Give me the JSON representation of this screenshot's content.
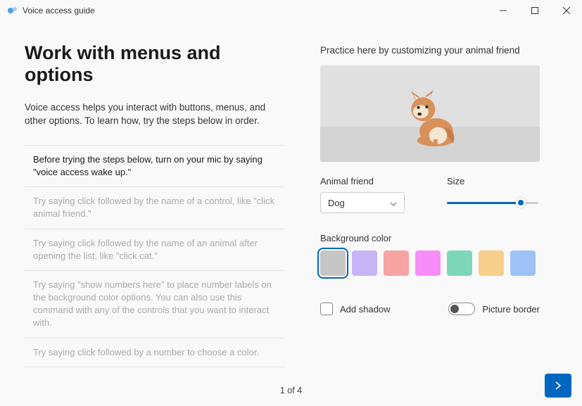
{
  "window": {
    "title": "Voice access guide"
  },
  "header": {
    "title": "Work with menus and options",
    "subtitle": "Voice access helps you interact with buttons, menus, and other options. To learn how, try the steps below in order."
  },
  "steps": [
    {
      "text": "Before trying the steps below, turn on your mic by saying \"voice access wake up.\"",
      "active": true
    },
    {
      "text": "Try saying click followed by the name of a control, like \"click animal friend.\"",
      "active": false
    },
    {
      "text": "Try saying click followed by the name of an animal after opening the list, like \"click cat.\"",
      "active": false
    },
    {
      "text": "Try saying \"show numbers here\" to place number labels on the background color options. You can also use this command with any of the controls that you want to interact with.",
      "active": false
    },
    {
      "text": "Try saying click followed by a number to choose a color.",
      "active": false
    }
  ],
  "practice": {
    "label": "Practice here by customizing your animal friend",
    "animal_label": "Animal friend",
    "animal_value": "Dog",
    "size_label": "Size",
    "bg_label": "Background color",
    "colors": [
      {
        "hex": "#c6c6c6",
        "selected": true
      },
      {
        "hex": "#c6b4f7",
        "selected": false
      },
      {
        "hex": "#f5a3a3",
        "selected": false
      },
      {
        "hex": "#f78df7",
        "selected": false
      },
      {
        "hex": "#7ed6b8",
        "selected": false
      },
      {
        "hex": "#f7cf8a",
        "selected": false
      },
      {
        "hex": "#9cc2f7",
        "selected": false
      }
    ],
    "shadow_label": "Add shadow",
    "border_label": "Picture border"
  },
  "footer": {
    "page": "1 of 4"
  }
}
